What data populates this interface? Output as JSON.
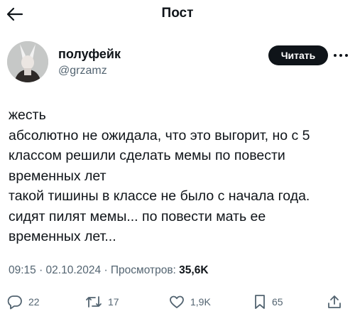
{
  "header": {
    "title": "Пост"
  },
  "author": {
    "name": "полуфейк",
    "handle": "@grzamz",
    "read_button": "Читать"
  },
  "tweet": {
    "lines": [
      "жесть",
      "абсолютно не ожидала, что это выгорит, но с 5",
      "классом решили сделать мемы по повести",
      "временных лет",
      "такой тишины в классе не было с начала года.",
      "сидят пилят мемы... по повести мать ее",
      "временных лет..."
    ]
  },
  "meta": {
    "time_date": "09:15 · 02.10.2024 · Просмотров: ",
    "views": "35,6K"
  },
  "actions": {
    "replies": "22",
    "reposts": "17",
    "likes": "1,9K",
    "bookmarks": "65"
  },
  "icons": [
    "back-arrow-icon",
    "more-icon",
    "reply-icon",
    "repost-icon",
    "like-icon",
    "bookmark-icon",
    "share-icon"
  ]
}
